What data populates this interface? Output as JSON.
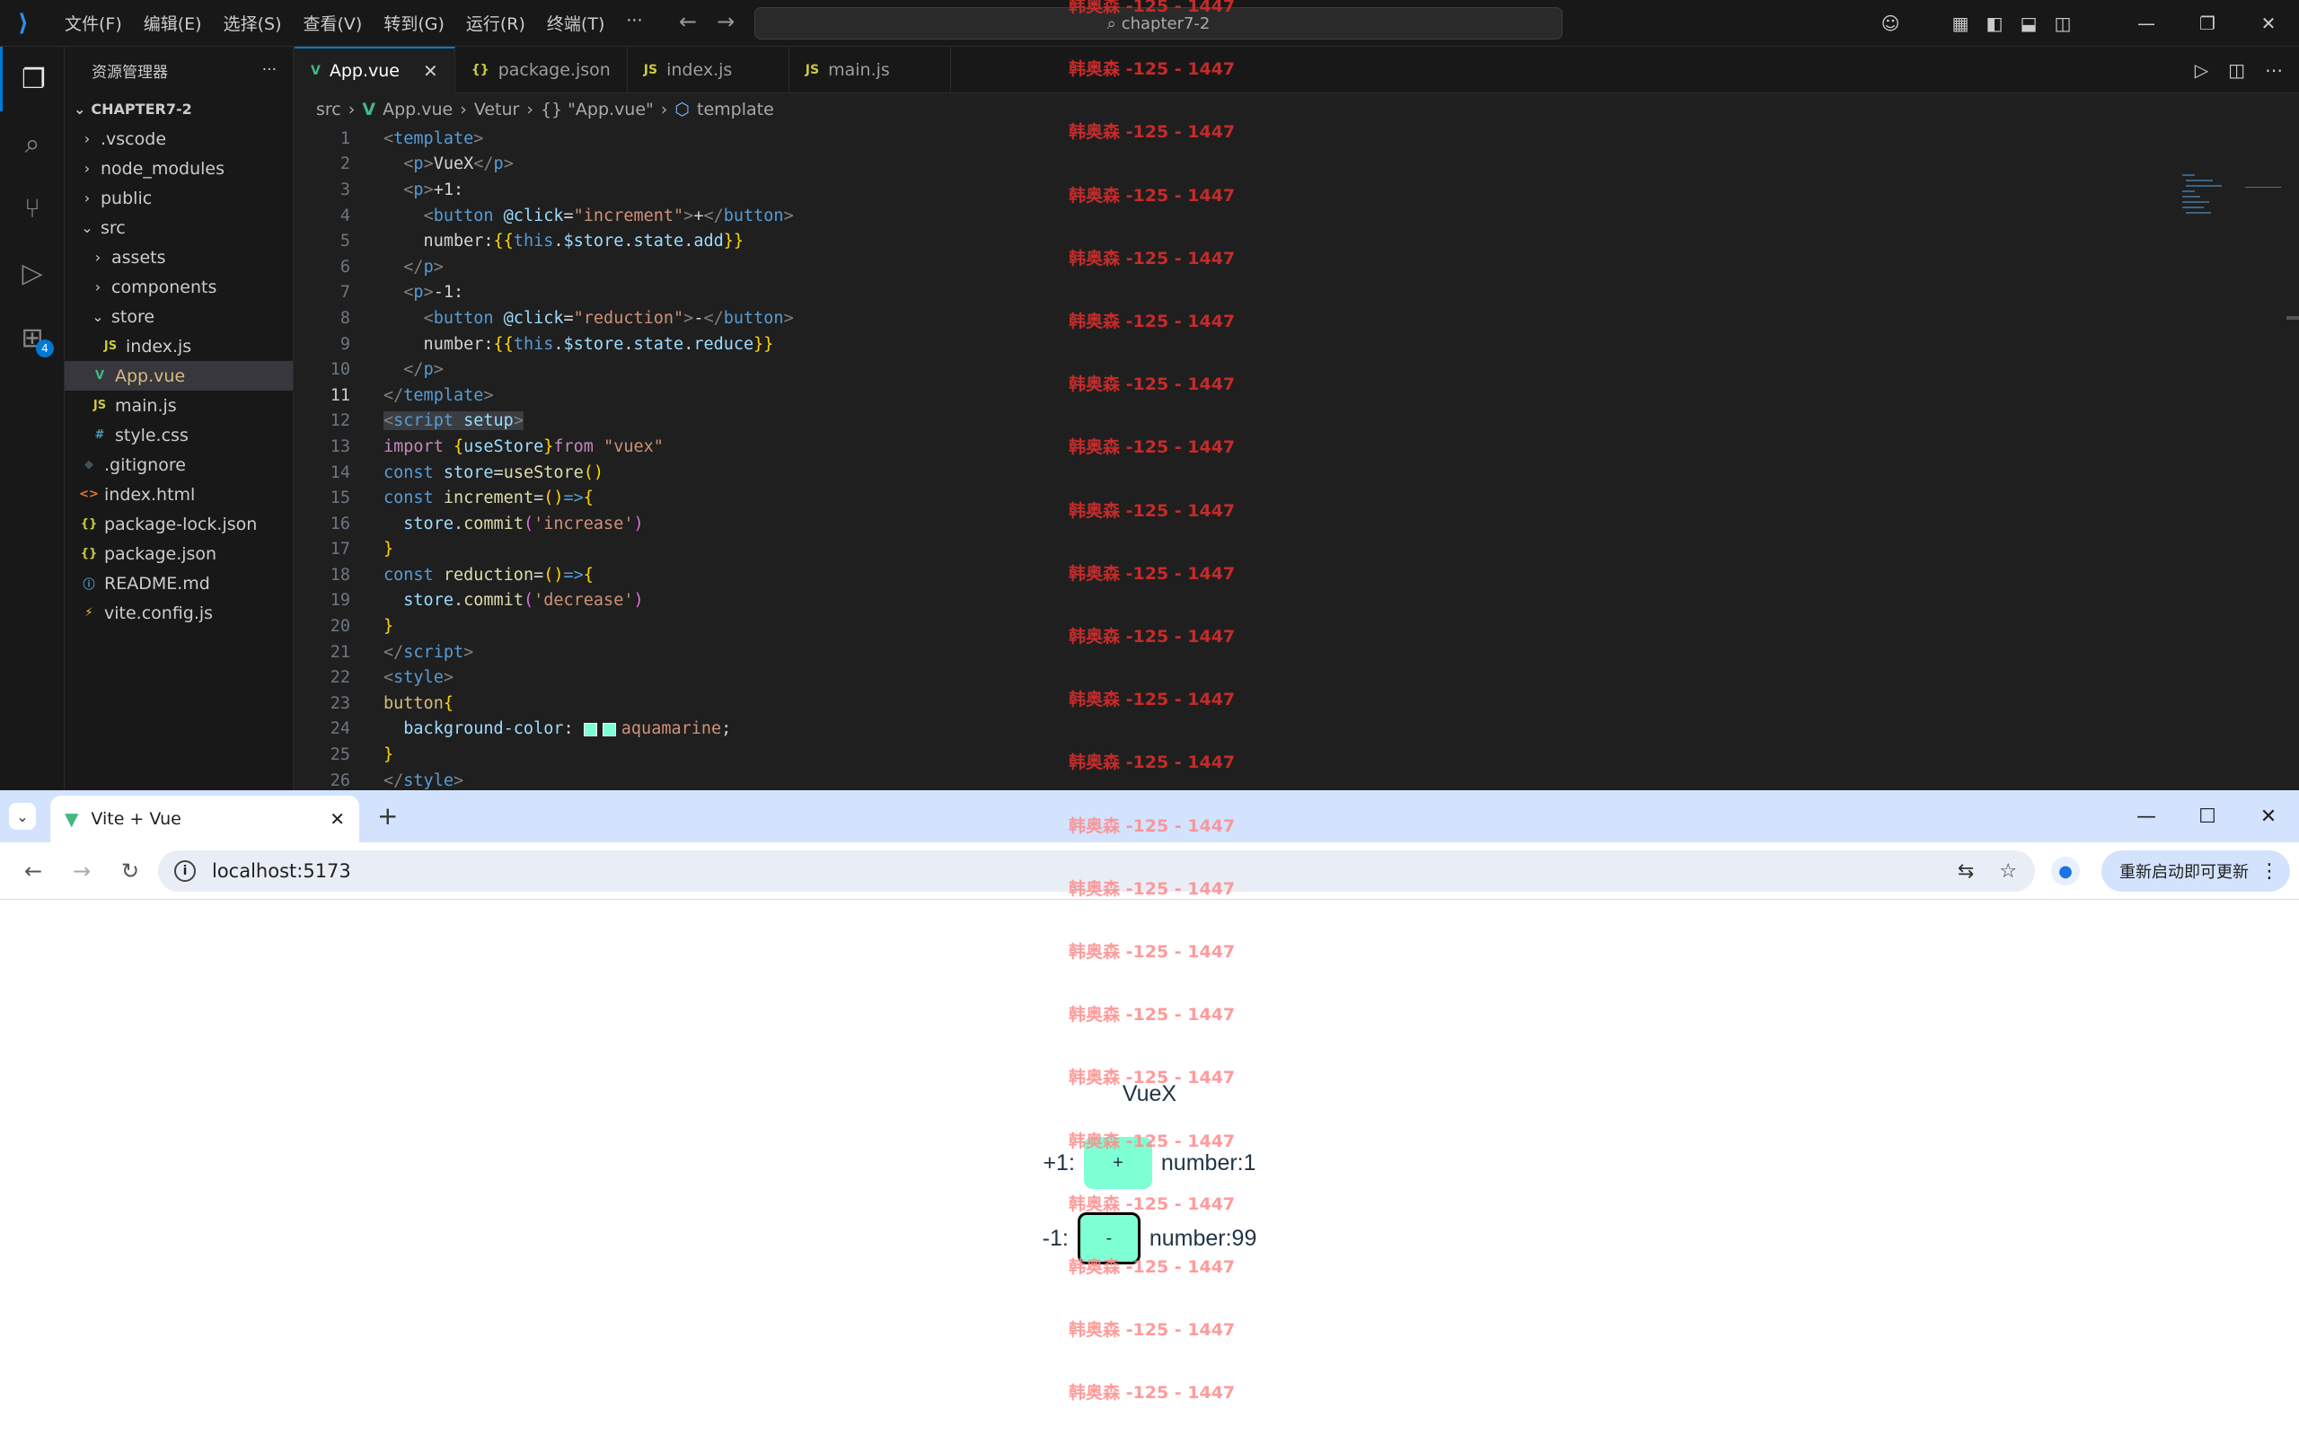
{
  "menubar": {
    "items": [
      "文件(F)",
      "编辑(E)",
      "选择(S)",
      "查看(V)",
      "转到(G)",
      "运行(R)",
      "终端(T)",
      "···"
    ],
    "command_center": "chapter7-2"
  },
  "explorer": {
    "title": "资源管理器",
    "more": "···",
    "section": "CHAPTER7-2",
    "tree": [
      {
        "label": ".vscode",
        "depth": 1,
        "kind": "folder",
        "open": false
      },
      {
        "label": "node_modules",
        "depth": 1,
        "kind": "folder",
        "open": false
      },
      {
        "label": "public",
        "depth": 1,
        "kind": "folder",
        "open": false
      },
      {
        "label": "src",
        "depth": 1,
        "kind": "folder",
        "open": true
      },
      {
        "label": "assets",
        "depth": 2,
        "kind": "folder",
        "open": false
      },
      {
        "label": "components",
        "depth": 2,
        "kind": "folder",
        "open": false
      },
      {
        "label": "store",
        "depth": 2,
        "kind": "folder",
        "open": true
      },
      {
        "label": "index.js",
        "depth": 3,
        "kind": "js"
      },
      {
        "label": "App.vue",
        "depth": 2,
        "kind": "vue",
        "selected": true
      },
      {
        "label": "main.js",
        "depth": 2,
        "kind": "js"
      },
      {
        "label": "style.css",
        "depth": 2,
        "kind": "css"
      },
      {
        "label": ".gitignore",
        "depth": 1,
        "kind": "git"
      },
      {
        "label": "index.html",
        "depth": 1,
        "kind": "html"
      },
      {
        "label": "package-lock.json",
        "depth": 1,
        "kind": "json"
      },
      {
        "label": "package.json",
        "depth": 1,
        "kind": "json"
      },
      {
        "label": "README.md",
        "depth": 1,
        "kind": "info"
      },
      {
        "label": "vite.config.js",
        "depth": 1,
        "kind": "vite"
      }
    ]
  },
  "activity_badge": "4",
  "editor_tabs": [
    {
      "label": "App.vue",
      "icon": "V",
      "active": true
    },
    {
      "label": "package.json",
      "icon": "{}",
      "active": false
    },
    {
      "label": "index.js",
      "icon": "JS",
      "active": false
    },
    {
      "label": "main.js",
      "icon": "JS",
      "active": false
    }
  ],
  "breadcrumb": [
    "src",
    "App.vue",
    "Vetur",
    "{} \"App.vue\"",
    "template"
  ],
  "current_line": 11,
  "code_lines": [
    [
      [
        "tg",
        "<"
      ],
      [
        "tn",
        "template"
      ],
      [
        "tg",
        ">"
      ]
    ],
    [
      [
        "pl",
        "  "
      ],
      [
        "tg",
        "<"
      ],
      [
        "tn",
        "p"
      ],
      [
        "tg",
        ">"
      ],
      [
        "pl",
        "VueX"
      ],
      [
        "tg",
        "</"
      ],
      [
        "tn",
        "p"
      ],
      [
        "tg",
        ">"
      ]
    ],
    [
      [
        "pl",
        "  "
      ],
      [
        "tg",
        "<"
      ],
      [
        "tn",
        "p"
      ],
      [
        "tg",
        ">"
      ],
      [
        "pl",
        "+1:"
      ]
    ],
    [
      [
        "pl",
        "    "
      ],
      [
        "tg",
        "<"
      ],
      [
        "tn",
        "button"
      ],
      [
        "pl",
        " "
      ],
      [
        "an",
        "@click"
      ],
      [
        "pl",
        "="
      ],
      [
        "sv",
        "\"increment\""
      ],
      [
        "tg",
        ">"
      ],
      [
        "pl",
        "+"
      ],
      [
        "tg",
        "</"
      ],
      [
        "tn",
        "button"
      ],
      [
        "tg",
        ">"
      ]
    ],
    [
      [
        "pl",
        "    number:"
      ],
      [
        "br",
        "{{"
      ],
      [
        "kw",
        "this"
      ],
      [
        "pl",
        "."
      ],
      [
        "vr",
        "$store"
      ],
      [
        "pl",
        "."
      ],
      [
        "vr",
        "state"
      ],
      [
        "pl",
        "."
      ],
      [
        "vr",
        "add"
      ],
      [
        "br",
        "}}"
      ]
    ],
    [
      [
        "pl",
        "  "
      ],
      [
        "tg",
        "</"
      ],
      [
        "tn",
        "p"
      ],
      [
        "tg",
        ">"
      ]
    ],
    [
      [
        "pl",
        "  "
      ],
      [
        "tg",
        "<"
      ],
      [
        "tn",
        "p"
      ],
      [
        "tg",
        ">"
      ],
      [
        "pl",
        "-1:"
      ]
    ],
    [
      [
        "pl",
        "    "
      ],
      [
        "tg",
        "<"
      ],
      [
        "tn",
        "button"
      ],
      [
        "pl",
        " "
      ],
      [
        "an",
        "@click"
      ],
      [
        "pl",
        "="
      ],
      [
        "sv",
        "\"reduction\""
      ],
      [
        "tg",
        ">"
      ],
      [
        "pl",
        "-"
      ],
      [
        "tg",
        "</"
      ],
      [
        "tn",
        "button"
      ],
      [
        "tg",
        ">"
      ]
    ],
    [
      [
        "pl",
        "    number:"
      ],
      [
        "br",
        "{{"
      ],
      [
        "kw",
        "this"
      ],
      [
        "pl",
        "."
      ],
      [
        "vr",
        "$store"
      ],
      [
        "pl",
        "."
      ],
      [
        "vr",
        "state"
      ],
      [
        "pl",
        "."
      ],
      [
        "vr",
        "reduce"
      ],
      [
        "br",
        "}}"
      ]
    ],
    [
      [
        "pl",
        "  "
      ],
      [
        "tg",
        "</"
      ],
      [
        "tn",
        "p"
      ],
      [
        "tg",
        ">"
      ]
    ],
    [
      [
        "tg",
        "</"
      ],
      [
        "tn",
        "template"
      ],
      [
        "tg",
        ">"
      ]
    ],
    [
      [
        "tg",
        "<"
      ],
      [
        "tn",
        "script"
      ],
      [
        "pl",
        " "
      ],
      [
        "an",
        "setup"
      ],
      [
        "tg",
        ">"
      ]
    ],
    [
      [
        "kwp",
        "import"
      ],
      [
        "pl",
        " "
      ],
      [
        "br",
        "{"
      ],
      [
        "vr",
        "useStore"
      ],
      [
        "br",
        "}"
      ],
      [
        "kwp",
        "from"
      ],
      [
        "pl",
        " "
      ],
      [
        "sv",
        "\"vuex\""
      ]
    ],
    [
      [
        "kw",
        "const"
      ],
      [
        "pl",
        " "
      ],
      [
        "vr",
        "store"
      ],
      [
        "pl",
        "="
      ],
      [
        "fn",
        "useStore"
      ],
      [
        "br",
        "()"
      ]
    ],
    [
      [
        "kw",
        "const"
      ],
      [
        "pl",
        " "
      ],
      [
        "fn",
        "increment"
      ],
      [
        "pl",
        "="
      ],
      [
        "br",
        "()"
      ],
      [
        "kw",
        "=>"
      ],
      [
        "br",
        "{"
      ]
    ],
    [
      [
        "pl",
        "  "
      ],
      [
        "vr",
        "store"
      ],
      [
        "pl",
        "."
      ],
      [
        "fn",
        "commit"
      ],
      [
        "br2",
        "("
      ],
      [
        "sv",
        "'increase'"
      ],
      [
        "br2",
        ")"
      ]
    ],
    [
      [
        "br",
        "}"
      ]
    ],
    [
      [
        "kw",
        "const"
      ],
      [
        "pl",
        " "
      ],
      [
        "fn",
        "reduction"
      ],
      [
        "pl",
        "="
      ],
      [
        "br",
        "()"
      ],
      [
        "kw",
        "=>"
      ],
      [
        "br",
        "{"
      ]
    ],
    [
      [
        "pl",
        "  "
      ],
      [
        "vr",
        "store"
      ],
      [
        "pl",
        "."
      ],
      [
        "fn",
        "commit"
      ],
      [
        "br2",
        "("
      ],
      [
        "sv",
        "'decrease'"
      ],
      [
        "br2",
        ")"
      ]
    ],
    [
      [
        "br",
        "}"
      ]
    ],
    [
      [
        "tg",
        "</"
      ],
      [
        "tn",
        "script"
      ],
      [
        "tg",
        ">"
      ]
    ],
    [
      [
        "tg",
        "<"
      ],
      [
        "tn",
        "style"
      ],
      [
        "tg",
        ">"
      ]
    ],
    [
      [
        "sel",
        "button"
      ],
      [
        "br",
        "{"
      ]
    ],
    [
      [
        "pl",
        "  "
      ],
      [
        "an",
        "background-color"
      ],
      [
        "pl",
        ": "
      ],
      [
        "sw",
        ""
      ],
      [
        "sv",
        "aquamarine"
      ],
      [
        "pl",
        ";"
      ]
    ],
    [
      [
        "br",
        "}"
      ]
    ],
    [
      [
        "tg",
        "</"
      ],
      [
        "tn",
        "style"
      ],
      [
        "tg",
        ">"
      ]
    ]
  ],
  "browser": {
    "tab_title": "Vite + Vue",
    "url": "localhost:5173",
    "relaunch_label": "重新启动即可更新",
    "new_tab": "+"
  },
  "app": {
    "title": "VueX",
    "row1_label": "+1:",
    "row1_button": "+",
    "row1_value": "number:1",
    "row2_label": "-1:",
    "row2_button": "-",
    "row2_value": "number:99",
    "button_color": "#7fffd4"
  },
  "watermark": {
    "text": "韩奥森 -125 - 1447",
    "editor_color": "#c42b2b",
    "page_color": "#ff8a8a"
  }
}
